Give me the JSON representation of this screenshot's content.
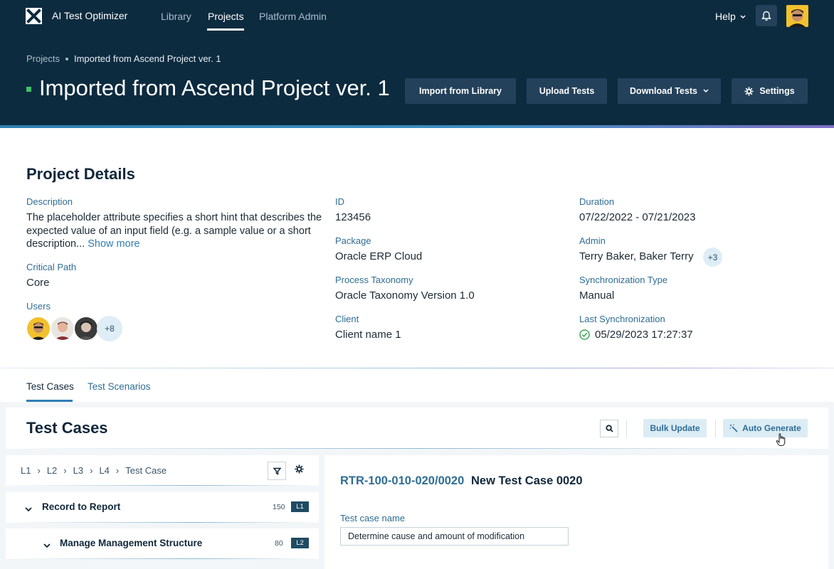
{
  "app": {
    "name": "AI Test Optimizer",
    "nav": [
      "Library",
      "Projects",
      "Platform Admin"
    ],
    "help_label": "Help",
    "logo_icon": "x-logo-icon",
    "bell_icon": "bell-icon"
  },
  "breadcrumb": {
    "root": "Projects",
    "current": "Imported from Ascend Project ver. 1"
  },
  "page_title": "Imported from Ascend Project ver. 1",
  "header_buttons": {
    "import": "Import from Library",
    "upload": "Upload Tests",
    "download": "Download Tests",
    "settings": "Settings"
  },
  "details": {
    "title": "Project Details",
    "description_label": "Description",
    "description": "The placeholder attribute specifies a short hint that describes the expected value of an input field (e.g. a sample value or a short description...",
    "show_more": "Show more",
    "critical_path_label": "Critical Path",
    "critical_path": "Core",
    "users_label": "Users",
    "users_extra": "+8",
    "id_label": "ID",
    "id": "123456",
    "package_label": "Package",
    "package": "Oracle ERP Cloud",
    "taxonomy_label": "Process Taxonomy",
    "taxonomy": "Oracle Taxonomy Version 1.0",
    "client_label": "Client",
    "client": "Client name 1",
    "duration_label": "Duration",
    "duration": "07/22/2022 - 07/21/2023",
    "admin_label": "Admin",
    "admin": "Terry Baker, Baker Terry",
    "admin_extra": "+3",
    "sync_type_label": "Synchronization Type",
    "sync_type": "Manual",
    "last_sync_label": "Last Synchronization",
    "last_sync": "05/29/2023 17:27:37"
  },
  "tabs": [
    "Test Cases",
    "Test Scenarios"
  ],
  "test_cases": {
    "title": "Test Cases",
    "bulk_update": "Bulk Update",
    "auto_generate": "Auto Generate",
    "tree_crumbs": [
      "L1",
      "L2",
      "L3",
      "L4",
      "Test Case"
    ],
    "tree_rows": [
      {
        "label": "Record to Report",
        "count": "150",
        "level": "L1"
      },
      {
        "label": "Manage Management Structure",
        "count": "80",
        "level": "L2"
      }
    ],
    "selected": {
      "id": "RTR-100-010-020/0020",
      "name": "New Test Case 0020",
      "name_label": "Test case name",
      "name_value": "Determine cause and amount of modification"
    }
  },
  "colors": {
    "header_bg": "#0d2b3f",
    "accent": "#2f7fb4",
    "status_green": "#42c06a"
  }
}
